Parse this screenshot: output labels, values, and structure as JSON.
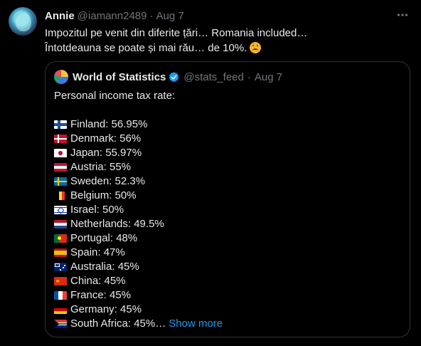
{
  "tweet": {
    "author_name": "Annie",
    "author_handle": "@iamann2489",
    "separator": "·",
    "date": "Aug 7",
    "text_line1": "Impozitul pe venit din diferite țări… Romania included…",
    "text_line2": "Întotdeauna se poate și mai rău… de 10%.",
    "emoji_icon": "upside-down-face-icon"
  },
  "quote": {
    "author_name": "World of Statistics",
    "author_handle": "@stats_feed",
    "separator": "·",
    "date": "Aug 7",
    "verified_icon": "verified-badge-icon",
    "intro": "Personal income tax rate:",
    "rows": [
      {
        "flag": "finland-flag-icon",
        "text": "Finland: 56.95%"
      },
      {
        "flag": "denmark-flag-icon",
        "text": "Denmark: 56%"
      },
      {
        "flag": "japan-flag-icon",
        "text": "Japan: 55.97%"
      },
      {
        "flag": "austria-flag-icon",
        "text": "Austria: 55%"
      },
      {
        "flag": "sweden-flag-icon",
        "text": "Sweden: 52.3%"
      },
      {
        "flag": "belgium-flag-icon",
        "text": "Belgium: 50%"
      },
      {
        "flag": "israel-flag-icon",
        "text": "Israel: 50%"
      },
      {
        "flag": "netherlands-flag-icon",
        "text": "Netherlands: 49.5%"
      },
      {
        "flag": "portugal-flag-icon",
        "text": "Portugal: 48%"
      },
      {
        "flag": "spain-flag-icon",
        "text": "Spain: 47%"
      },
      {
        "flag": "australia-flag-icon",
        "text": "Australia: 45%"
      },
      {
        "flag": "china-flag-icon",
        "text": "China: 45%"
      },
      {
        "flag": "france-flag-icon",
        "text": "France: 45%"
      },
      {
        "flag": "germany-flag-icon",
        "text": "Germany: 45%"
      },
      {
        "flag": "south-africa-flag-icon",
        "text": "South Africa: 45%…"
      }
    ],
    "show_more": "Show more"
  },
  "more_icon": "more-options-icon",
  "colors": {
    "background": "#000000",
    "text": "#e7e9ea",
    "muted": "#71767b",
    "link": "#1d9bf0",
    "border": "#2f3336"
  }
}
